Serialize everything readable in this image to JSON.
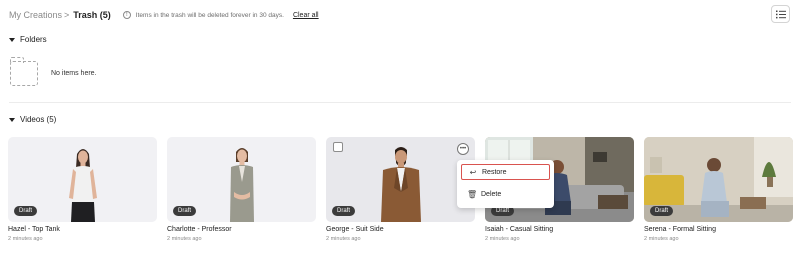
{
  "breadcrumb": {
    "parent": "My Creations",
    "separator": ">",
    "current": "Trash (5)"
  },
  "info_text": "Items in the trash will be deleted forever in 30 days.",
  "clear_all": "Clear all",
  "folders": {
    "title": "Folders",
    "empty_text": "No items here."
  },
  "videos": {
    "title": "Videos (5)",
    "items": [
      {
        "title": "Hazel - Top Tank",
        "badge": "Draft",
        "time": "2 minutes ago"
      },
      {
        "title": "Charlotte - Professor",
        "badge": "Draft",
        "time": "2 minutes ago"
      },
      {
        "title": "George - Suit Side",
        "badge": "Draft",
        "time": "2 minutes ago"
      },
      {
        "title": "Isaiah - Casual Sitting",
        "badge": "Draft",
        "time": "2 minutes ago"
      },
      {
        "title": "Serena - Formal Sitting",
        "badge": "Draft",
        "time": "2 minutes ago"
      }
    ]
  },
  "context_menu": {
    "restore": "Restore",
    "delete": "Delete"
  },
  "colors": {
    "highlight": "#d9534f",
    "badge_bg": "#3b3b3b"
  }
}
